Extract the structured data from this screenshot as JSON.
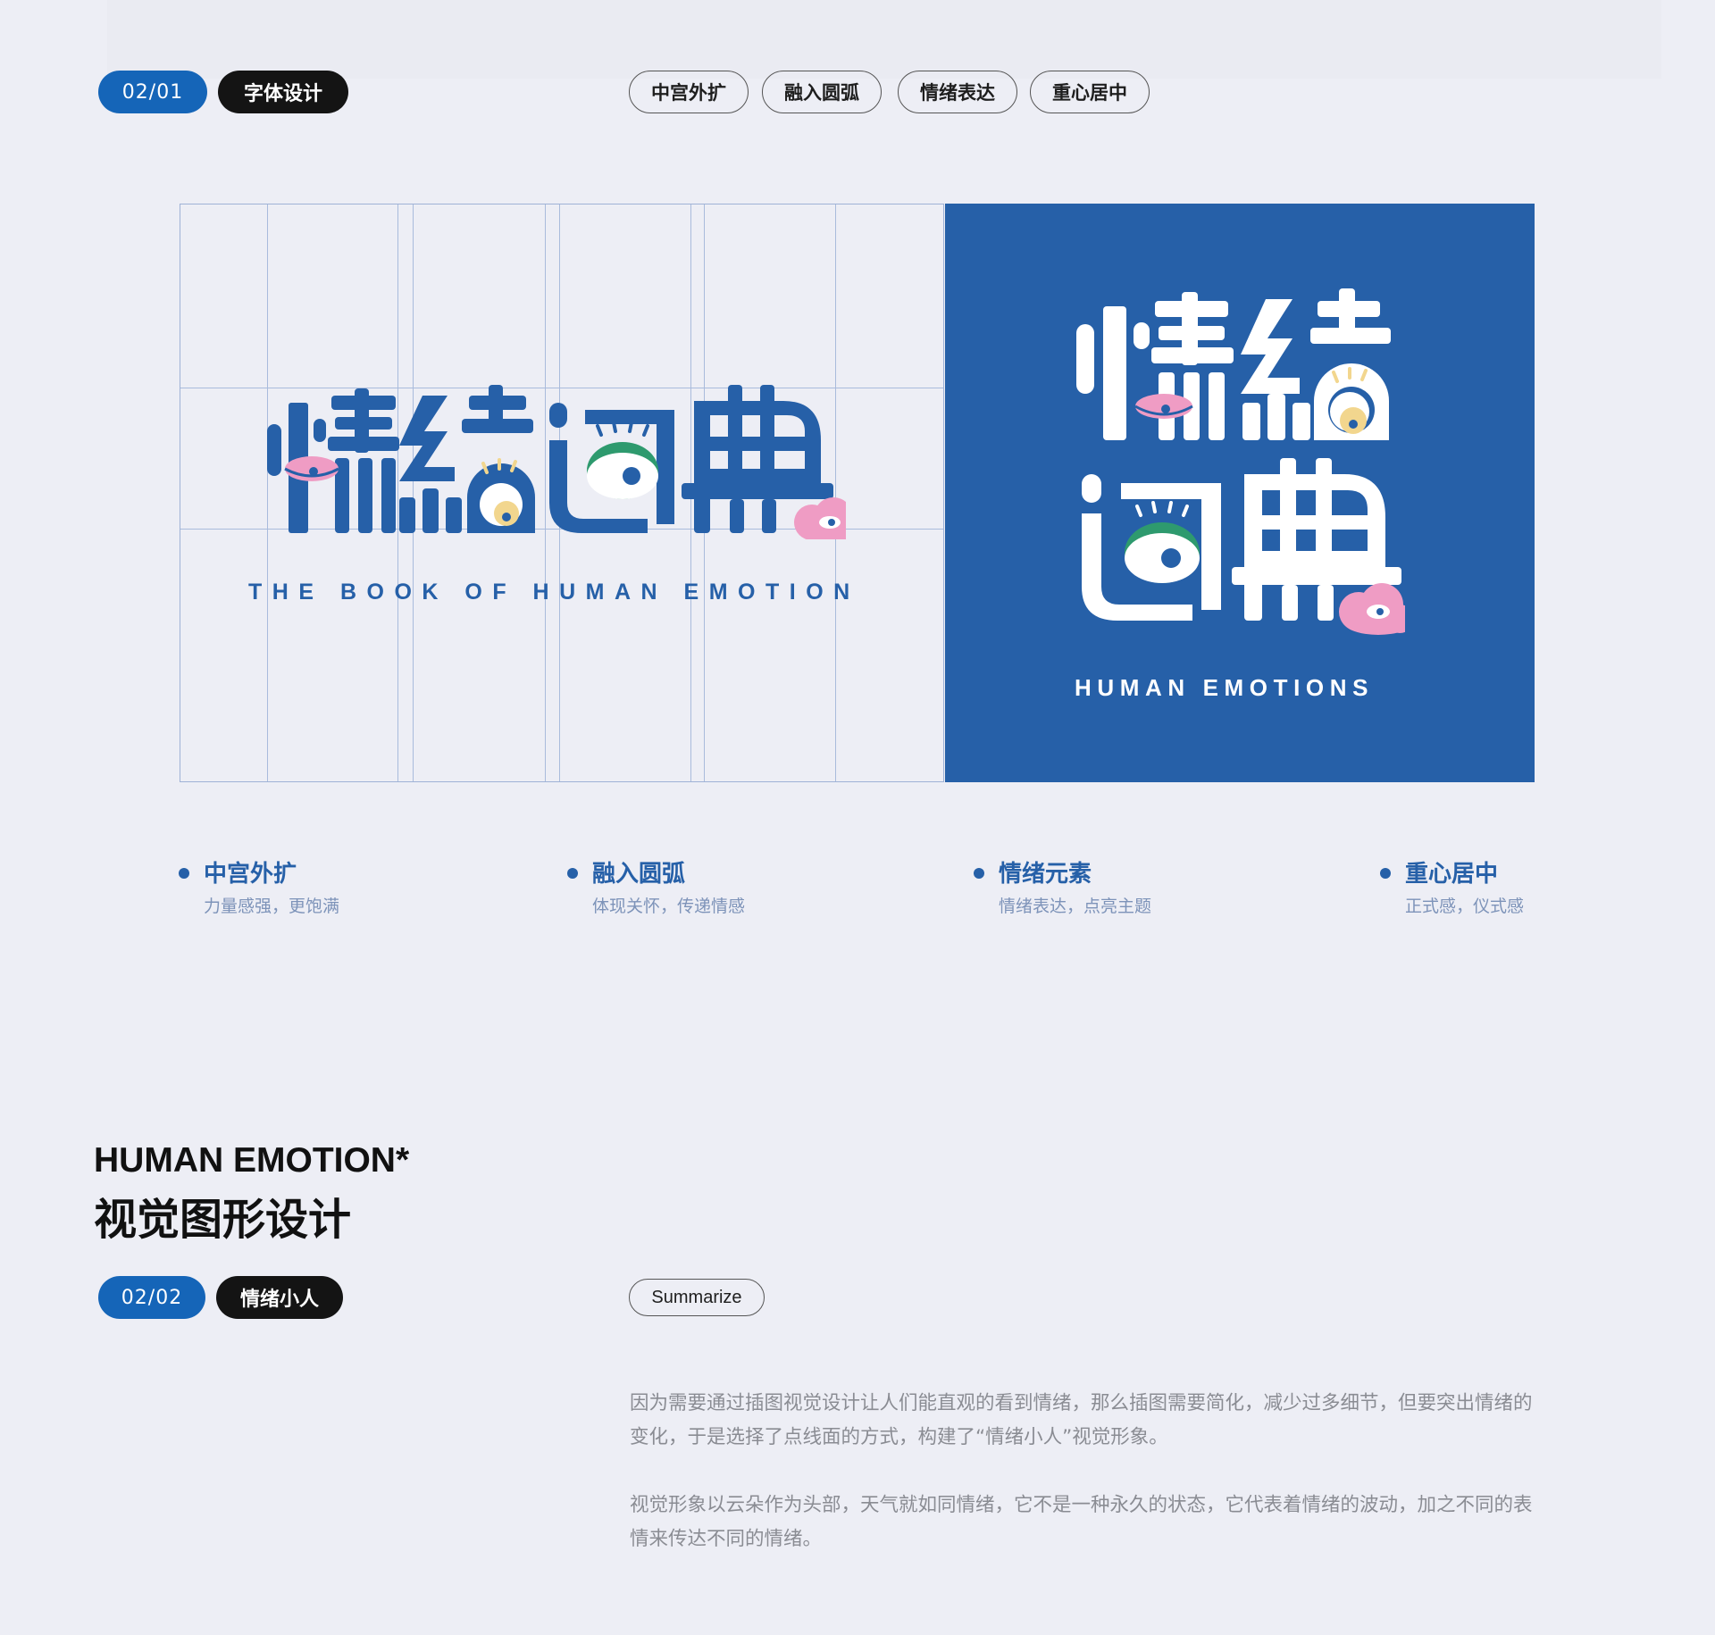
{
  "section1": {
    "number": "02/01",
    "category": "字体设计",
    "tags": [
      "中宫外扩",
      "融入圆弧",
      "情绪表达",
      "重心居中"
    ]
  },
  "logo": {
    "characters": [
      "情",
      "绪",
      "词",
      "典"
    ],
    "tagline_left": "THE BOOK OF HUMAN EMOTION",
    "tagline_right": "HUMAN EMOTIONS",
    "colors": {
      "brand_blue": "#2660a8",
      "pink": "#ef9cc4",
      "yellow": "#f2d68e",
      "green": "#2e9a6e",
      "white": "#ffffff"
    }
  },
  "features": [
    {
      "title": "中宫外扩",
      "desc": "力量感强，更饱满"
    },
    {
      "title": "融入圆弧",
      "desc": "体现关怀，传递情感"
    },
    {
      "title": "情绪元素",
      "desc": "情绪表达，点亮主题"
    },
    {
      "title": "重心居中",
      "desc": "正式感，仪式感"
    }
  ],
  "section2": {
    "heading_en": "HUMAN EMOTION*",
    "heading_cn": "视觉图形设计",
    "number": "02/02",
    "category": "情绪小人",
    "tag": "Summarize",
    "paragraphs": [
      "因为需要通过插图视觉设计让人们能直观的看到情绪，那么插图需要简化，减少过多细节，但要突出情绪的变化，于是选择了点线面的方式，构建了“情绪小人”视觉形象。",
      "视觉形象以云朵作为头部，天气就如同情绪，它不是一种永久的状态，它代表着情绪的波动，加之不同的表情来传达不同的情绪。"
    ]
  }
}
